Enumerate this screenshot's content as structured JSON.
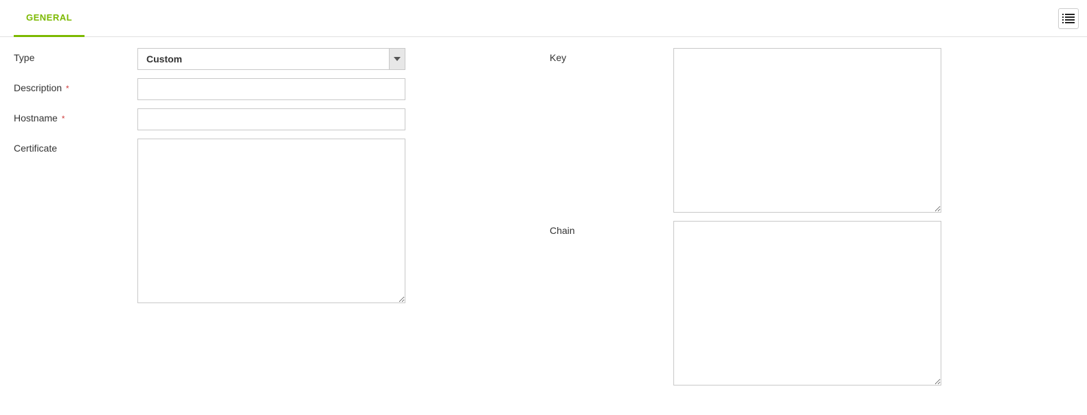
{
  "tabs": {
    "general": "GENERAL"
  },
  "form": {
    "type": {
      "label": "Type",
      "value": "Custom"
    },
    "description": {
      "label": "Description",
      "required": "*",
      "value": ""
    },
    "hostname": {
      "label": "Hostname",
      "required": "*",
      "value": ""
    },
    "certificate": {
      "label": "Certificate",
      "value": ""
    },
    "key": {
      "label": "Key",
      "value": ""
    },
    "chain": {
      "label": "Chain",
      "value": ""
    }
  }
}
